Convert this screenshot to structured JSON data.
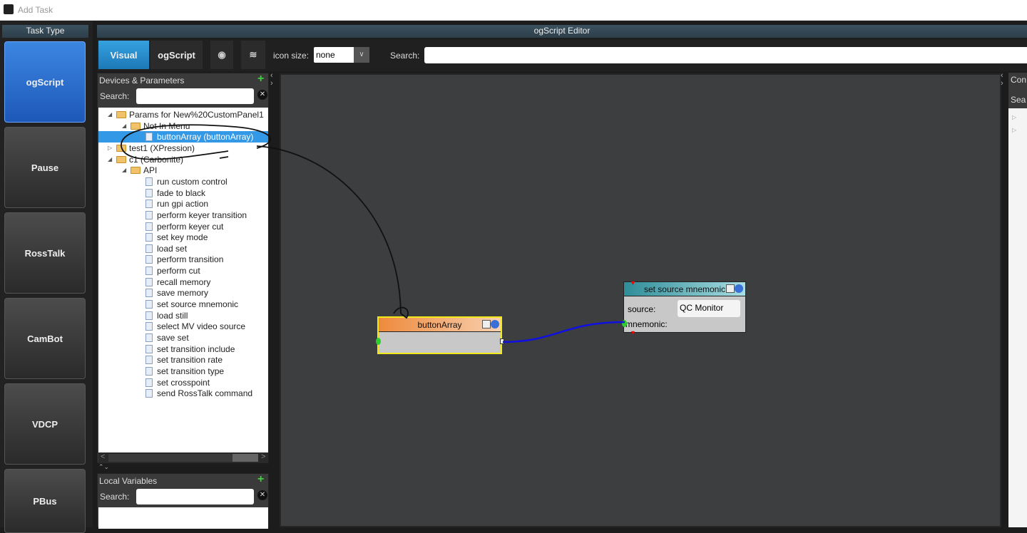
{
  "window": {
    "title": "Add Task"
  },
  "task_type": {
    "header": "Task Type",
    "buttons": [
      "ogScript",
      "Pause",
      "RossTalk",
      "CamBot",
      "VDCP",
      "PBus"
    ],
    "active": "ogScript"
  },
  "editor": {
    "title": "ogScript Editor",
    "tabs": [
      "Visual",
      "ogScript"
    ],
    "active_tab": "Visual",
    "icon_size_label": "icon size:",
    "icon_size_value": "none",
    "search_label": "Search:",
    "search_value": ""
  },
  "devices": {
    "header": "Devices & Parameters",
    "search_label": "Search:",
    "search_value": "",
    "tree": [
      {
        "label": "Params for New%20CustomPanel1",
        "level": 0,
        "type": "folder",
        "expanded": true
      },
      {
        "label": "Not In Menu",
        "level": 1,
        "type": "folder",
        "expanded": true
      },
      {
        "label": "buttonArray (buttonArray)",
        "level": 2,
        "type": "doc",
        "selected": true
      },
      {
        "label": "test1 (XPression)",
        "level": 0,
        "type": "folder",
        "expanded": false
      },
      {
        "label": "c1 (Carbonite)",
        "level": 0,
        "type": "folder",
        "expanded": true
      },
      {
        "label": "API",
        "level": 1,
        "type": "folder",
        "expanded": true
      },
      {
        "label": "run custom control",
        "level": 2,
        "type": "doc"
      },
      {
        "label": "fade to black",
        "level": 2,
        "type": "doc"
      },
      {
        "label": "run gpi action",
        "level": 2,
        "type": "doc"
      },
      {
        "label": "perform keyer transition",
        "level": 2,
        "type": "doc"
      },
      {
        "label": "perform keyer cut",
        "level": 2,
        "type": "doc"
      },
      {
        "label": "set key mode",
        "level": 2,
        "type": "doc"
      },
      {
        "label": "load set",
        "level": 2,
        "type": "doc"
      },
      {
        "label": "perform transition",
        "level": 2,
        "type": "doc"
      },
      {
        "label": "perform cut",
        "level": 2,
        "type": "doc"
      },
      {
        "label": "recall memory",
        "level": 2,
        "type": "doc"
      },
      {
        "label": "save memory",
        "level": 2,
        "type": "doc"
      },
      {
        "label": "set source mnemonic",
        "level": 2,
        "type": "doc"
      },
      {
        "label": "load still",
        "level": 2,
        "type": "doc"
      },
      {
        "label": "select MV video source",
        "level": 2,
        "type": "doc"
      },
      {
        "label": "save set",
        "level": 2,
        "type": "doc"
      },
      {
        "label": "set transition include",
        "level": 2,
        "type": "doc"
      },
      {
        "label": "set transition rate",
        "level": 2,
        "type": "doc"
      },
      {
        "label": "set transition type",
        "level": 2,
        "type": "doc"
      },
      {
        "label": "set crosspoint",
        "level": 2,
        "type": "doc"
      },
      {
        "label": "send RossTalk command",
        "level": 2,
        "type": "doc"
      }
    ]
  },
  "local_vars": {
    "header": "Local Variables",
    "search_label": "Search:",
    "search_value": ""
  },
  "right_panel": {
    "header": "Con",
    "search_label": "Sea"
  },
  "nodes": {
    "button_array": {
      "title": "buttonArray",
      "color": "#f0924a"
    },
    "set_source": {
      "title": "set source mnemonic",
      "source_label": "source:",
      "source_value": "QC Monitor",
      "mnemonic_label": "mnemonic:",
      "color": "#3a9aa6"
    }
  },
  "colors": {
    "accent": "#1d79b8",
    "connection": "#1010e0",
    "selection": "#3399e6"
  }
}
